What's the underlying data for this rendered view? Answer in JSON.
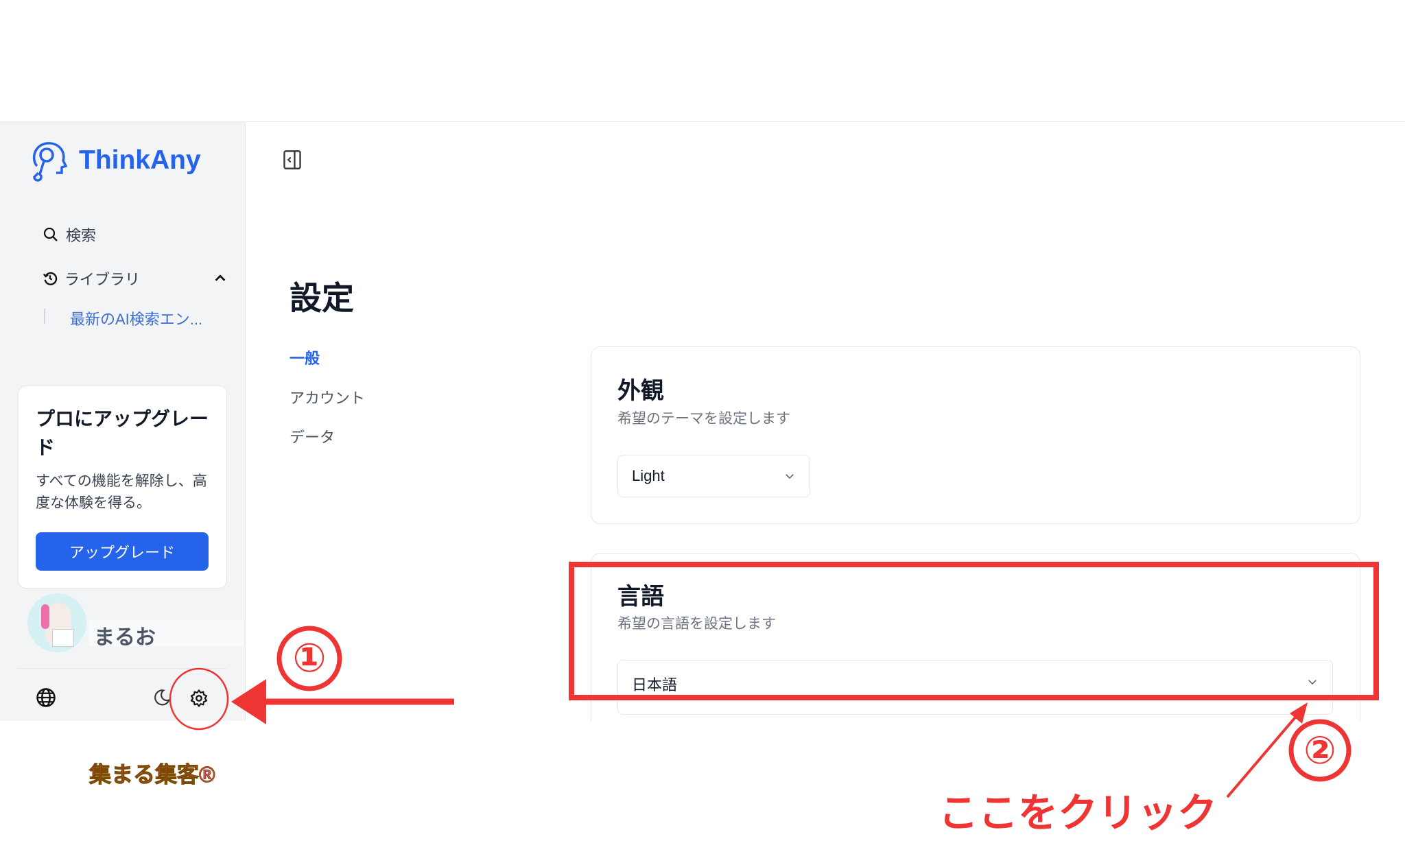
{
  "app": {
    "name": "ThinkAny",
    "accent": "#2563eb"
  },
  "sidebar": {
    "items": [
      {
        "label": "検索",
        "icon": "search-icon"
      },
      {
        "label": "ライブラリ",
        "icon": "history-icon"
      }
    ],
    "library_items": [
      "最新のAI検索エン..."
    ],
    "upgrade": {
      "title": "プロにアップグレード",
      "description": "すべての機能を解除し、高度な体験を得る。",
      "button": "アップグレード"
    },
    "user": {
      "name": "まるお"
    },
    "footer_icons": [
      "globe-icon",
      "moon-icon",
      "gear-icon"
    ]
  },
  "main": {
    "title": "設定",
    "tabs": [
      {
        "label": "一般",
        "active": true
      },
      {
        "label": "アカウント"
      },
      {
        "label": "データ"
      }
    ],
    "sections": [
      {
        "title": "外観",
        "subtitle": "希望のテーマを設定します",
        "value": "Light"
      },
      {
        "title": "言語",
        "subtitle": "希望の言語を設定します",
        "value": "日本語"
      }
    ]
  },
  "annotations": {
    "step1": "①",
    "step2": "②",
    "click_here": "ここをクリック",
    "color": "#ef3434",
    "watermark": "集まる集客®"
  }
}
